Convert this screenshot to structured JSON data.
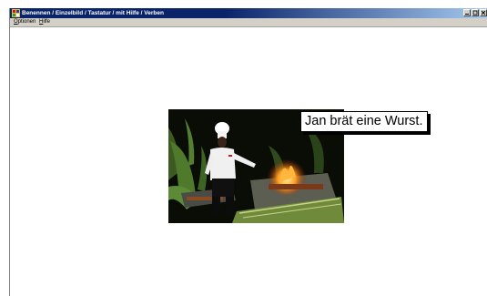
{
  "window": {
    "title": "Benennen / Einzelbild / Tastatur / mit Hilfe / Verben",
    "app_icon": "app-icon",
    "controls": [
      "minimize-icon",
      "maximize-icon",
      "close-icon"
    ]
  },
  "menu": {
    "items": [
      {
        "mnemonic": "O",
        "rest": "ptionen"
      },
      {
        "mnemonic": "H",
        "rest": "ilfe"
      }
    ]
  },
  "exercise": {
    "image_description_icon": "photo-chef-grilling",
    "caption": "Jan brät eine Wurst."
  },
  "colors": {
    "titlebar_start": "#0a246a",
    "titlebar_end": "#a6caf0",
    "menubar": "#d4d0c8",
    "background": "#ffffff"
  }
}
